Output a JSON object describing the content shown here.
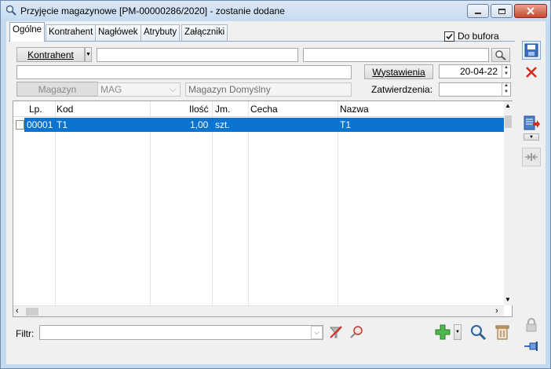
{
  "window": {
    "title": "Przyjęcie magazynowe [PM-00000286/2020]  - zostanie dodane"
  },
  "tabs": [
    {
      "label": "Ogólne"
    },
    {
      "label": "Kontrahent"
    },
    {
      "label": "Nagłówek"
    },
    {
      "label": "Atrybuty"
    },
    {
      "label": "Załączniki"
    }
  ],
  "do_bufora": {
    "label": "Do bufora",
    "checked": true
  },
  "form": {
    "kontrahent_button": "Kontrahent",
    "kontrahent_value": "",
    "kontrahent_name": "",
    "address": "",
    "wystawienia_button": "Wystawienia",
    "wystawienia_date": "20-04-22",
    "magazyn_button": "Magazyn",
    "magazyn_code": "MAG",
    "magazyn_name": "Magazyn Domyślny",
    "zatwierdzenia_label": "Zatwierdzenia:",
    "zatwierdzenia_value": ""
  },
  "grid": {
    "columns": [
      "Lp.",
      "Kod",
      "Ilość",
      "Jm.",
      "Cecha",
      "Nazwa"
    ],
    "rows": [
      {
        "lp": "00001",
        "kod": "T1",
        "ilosc": "1,00",
        "jm": "szt.",
        "cecha": "",
        "nazwa": "T1"
      }
    ]
  },
  "filter": {
    "label": "Filtr:",
    "value": ""
  },
  "colors": {
    "selection": "#0a74d0",
    "accent_red": "#d62b1e",
    "accent_green": "#2e9e2e"
  }
}
